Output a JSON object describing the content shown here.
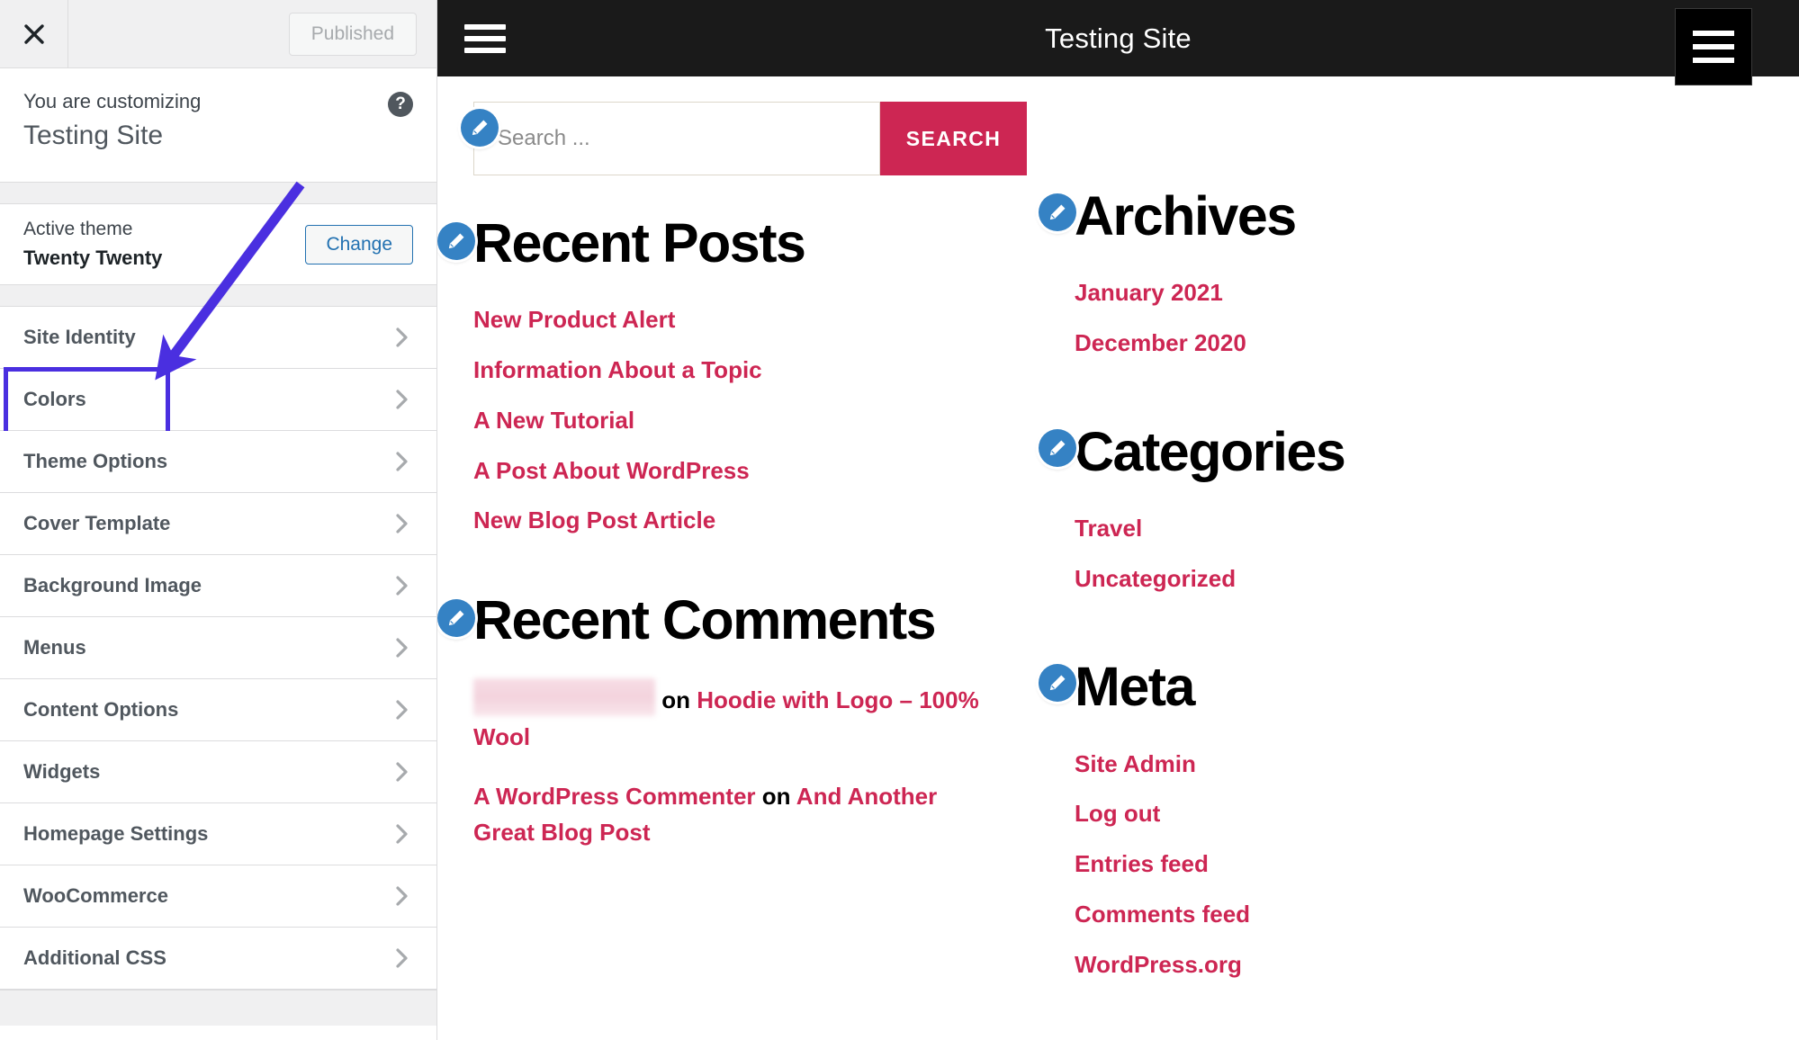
{
  "customizer": {
    "close_icon": "close-icon",
    "published_label": "Published",
    "help_icon": "help-icon",
    "header": {
      "subtitle": "You are customizing",
      "title": "Testing Site"
    },
    "theme": {
      "label": "Active theme",
      "name": "Twenty Twenty",
      "change_label": "Change"
    },
    "nav_items": [
      {
        "label": "Site Identity",
        "highlighted": false
      },
      {
        "label": "Colors",
        "highlighted": true
      },
      {
        "label": "Theme Options",
        "highlighted": false
      },
      {
        "label": "Cover Template",
        "highlighted": false
      },
      {
        "label": "Background Image",
        "highlighted": false
      },
      {
        "label": "Menus",
        "highlighted": false
      },
      {
        "label": "Content Options",
        "highlighted": false
      },
      {
        "label": "Widgets",
        "highlighted": false
      },
      {
        "label": "Homepage Settings",
        "highlighted": false
      },
      {
        "label": "WooCommerce",
        "highlighted": false
      },
      {
        "label": "Additional CSS",
        "highlighted": false
      }
    ],
    "annotation": {
      "type": "arrow",
      "color": "#4a2fe0",
      "points_to": "Colors",
      "highlight_color": "#4a2fe0"
    }
  },
  "preview": {
    "header": {
      "menu_icon_left": "hamburger-menu-icon",
      "site_title": "Testing Site",
      "menu_icon_right": "hamburger-menu-icon"
    },
    "search": {
      "placeholder": "Search ...",
      "value": "",
      "button_label": "SEARCH",
      "edit_icon": "pencil-edit-icon"
    },
    "widgets": {
      "recent_posts": {
        "title": "Recent Posts",
        "edit_icon": "pencil-edit-icon",
        "links": [
          "New Product Alert",
          "Information About a Topic",
          "A New Tutorial",
          "A Post About WordPress",
          "New Blog Post Article"
        ]
      },
      "recent_comments": {
        "title": "Recent Comments",
        "edit_icon": "pencil-edit-icon",
        "items": [
          {
            "author": "",
            "author_redacted": true,
            "connector": "on",
            "post": "Hoodie with Logo – 100% Wool"
          },
          {
            "author": "A WordPress Commenter",
            "author_redacted": false,
            "connector": "on",
            "post": "And Another Great Blog Post"
          }
        ]
      },
      "archives": {
        "title": "Archives",
        "edit_icon": "pencil-edit-icon",
        "links": [
          "January 2021",
          "December 2020"
        ]
      },
      "categories": {
        "title": "Categories",
        "edit_icon": "pencil-edit-icon",
        "links": [
          "Travel",
          "Uncategorized"
        ]
      },
      "meta": {
        "title": "Meta",
        "edit_icon": "pencil-edit-icon",
        "links": [
          "Site Admin",
          "Log out",
          "Entries feed",
          "Comments feed",
          "WordPress.org"
        ]
      }
    }
  },
  "colors": {
    "accent": "#cd2653",
    "header_bg": "#1a1a1a",
    "edit_icon_bg": "#3582c4",
    "annotation": "#4a2fe0",
    "link_blue": "#2271b1"
  }
}
